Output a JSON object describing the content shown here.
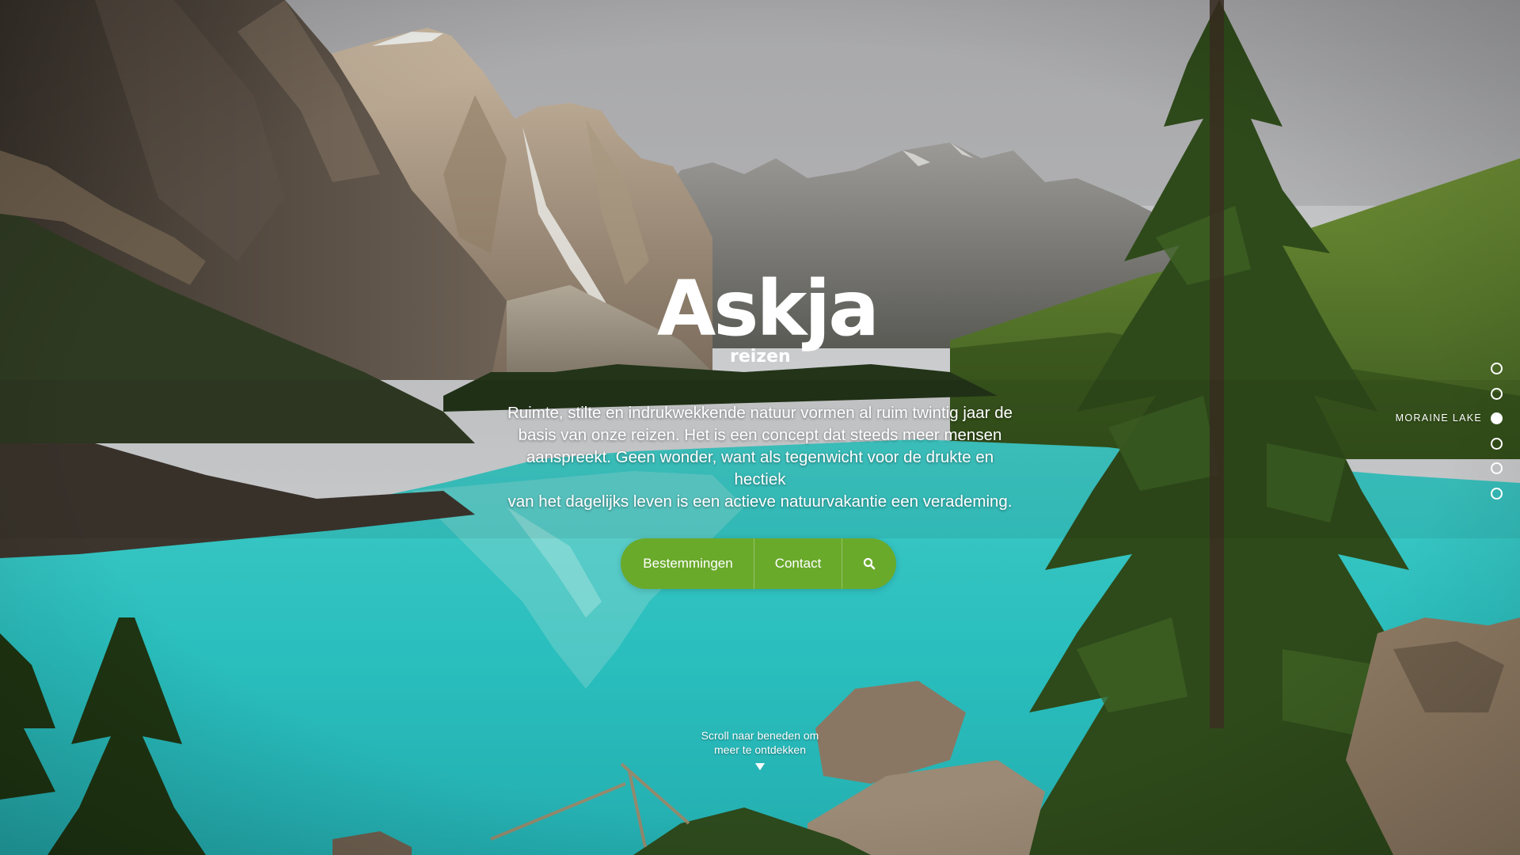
{
  "brand": {
    "name": "Askja",
    "sub": "reizen"
  },
  "hero": {
    "intro_lines": [
      "Ruimte, stilte en indrukwekkende natuur vormen al ruim twintig jaar de",
      "basis van onze reizen. Het is een concept dat steeds meer mensen",
      "aanspreekt. Geen wonder, want als tegenwicht voor de drukte en hectiek",
      "van het dagelijks leven is een actieve natuurvakantie een verademing."
    ]
  },
  "nav": {
    "destinations_label": "Bestemmingen",
    "contact_label": "Contact",
    "search_icon": "search-icon"
  },
  "scroll": {
    "line1": "Scroll naar beneden om",
    "line2": "meer te ontdekken"
  },
  "slides": {
    "count": 6,
    "active_index": 2,
    "active_label": "MORAINE LAKE"
  },
  "colors": {
    "accent_green": "#6aaa2b",
    "lake_turquoise": "#2cc3c3"
  }
}
